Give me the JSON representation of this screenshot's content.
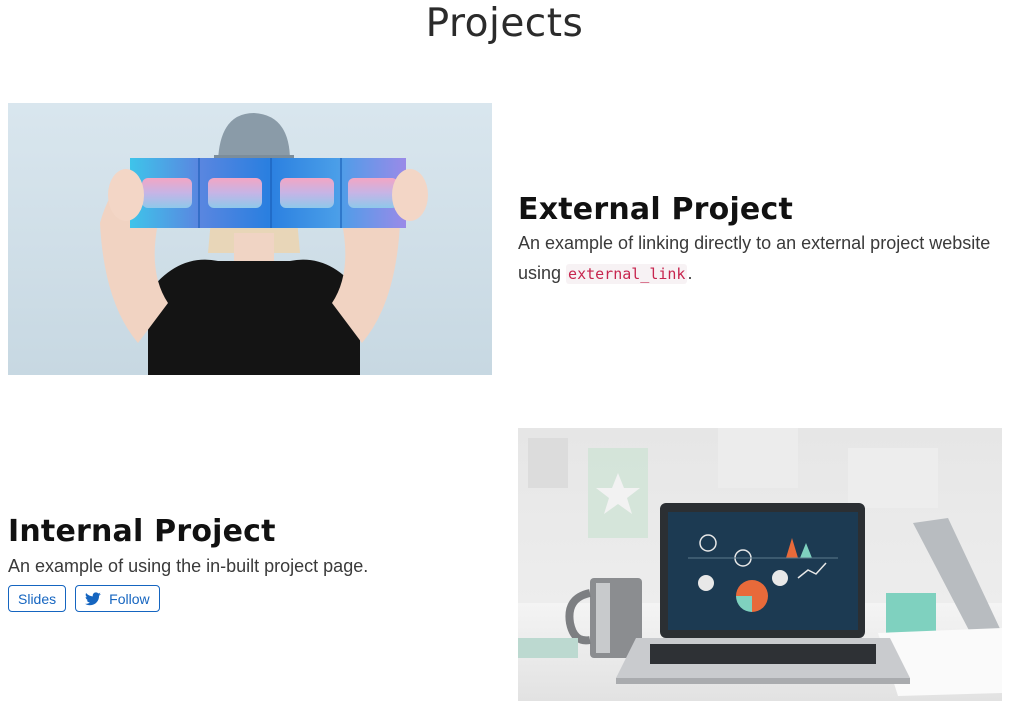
{
  "page": {
    "title": "Projects"
  },
  "projects": [
    {
      "title": "External Project",
      "summary_text": "An example of linking directly to an external project website using ",
      "summary_code": "external_link",
      "summary_end": ".",
      "image": "woman-holding-colorful-panel-photo"
    },
    {
      "title": "Internal Project",
      "summary_text": "An example of using the in-built project page.",
      "image": "laptop-on-desk-with-data-dashboard-photo",
      "buttons": [
        {
          "label": "Slides",
          "icon": ""
        },
        {
          "label": "Follow",
          "icon": "twitter-icon"
        }
      ]
    }
  ],
  "colors": {
    "button_accent": "#1565c0",
    "code_text": "#c7254e",
    "heading": "#111111"
  }
}
